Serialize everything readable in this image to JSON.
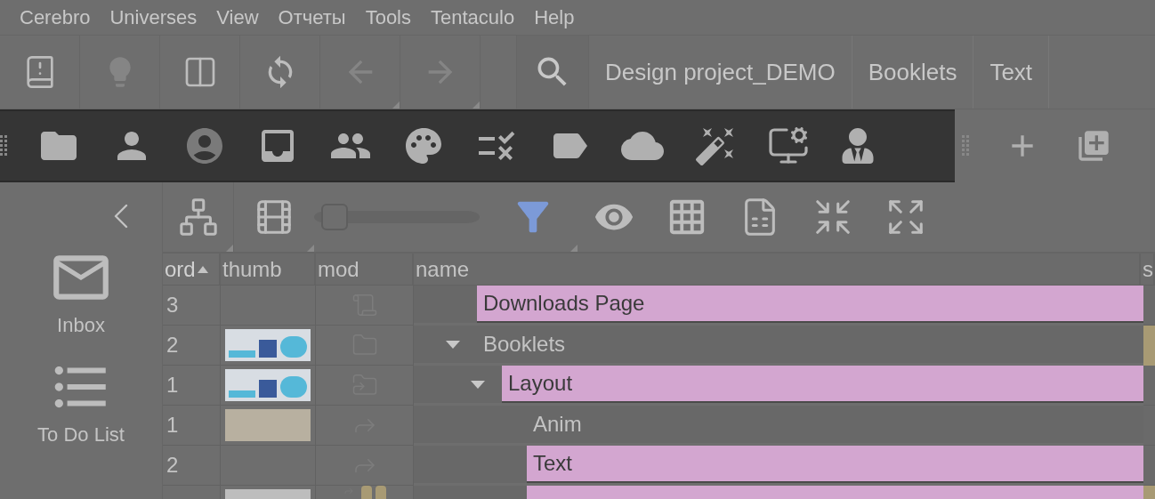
{
  "menu": [
    "Cerebro",
    "Universes",
    "View",
    "Отчеты",
    "Tools",
    "Tentaculo",
    "Help"
  ],
  "toolbar": [
    {
      "kind": "notes",
      "disabled": false
    },
    {
      "kind": "idea",
      "disabled": true
    },
    {
      "kind": "book",
      "disabled": false
    },
    {
      "kind": "refresh",
      "disabled": false
    },
    {
      "kind": "back",
      "disabled": true
    },
    {
      "kind": "forward",
      "disabled": true
    }
  ],
  "breadcrumbs": [
    "Design project_DEMO",
    "Booklets",
    "Text"
  ],
  "dark_toolbar": [
    {
      "kind": "folder"
    },
    {
      "kind": "person"
    },
    {
      "kind": "account"
    },
    {
      "kind": "inbox"
    },
    {
      "kind": "people"
    },
    {
      "kind": "palette"
    },
    {
      "kind": "rule"
    },
    {
      "kind": "label"
    },
    {
      "kind": "cloud"
    },
    {
      "kind": "magic"
    },
    {
      "kind": "monitor"
    },
    {
      "kind": "agent"
    }
  ],
  "side_tools": [
    {
      "kind": "add"
    },
    {
      "kind": "add-box"
    }
  ],
  "sidebar": {
    "items": [
      {
        "label": "Inbox",
        "kind": "mail"
      },
      {
        "label": "To Do List",
        "kind": "list"
      }
    ]
  },
  "view_toolbar": {
    "zoom": {
      "level": 0.05
    },
    "filter_active": true
  },
  "table": {
    "columns": [
      {
        "label": "ord",
        "sorted": true
      },
      {
        "label": "thumb",
        "sorted": false
      },
      {
        "label": "mod",
        "sorted": false
      },
      {
        "label": "name",
        "sorted": false
      },
      {
        "label": "s",
        "sorted": false
      }
    ],
    "rows": [
      {
        "ord": "3",
        "mod": {
          "kind": "scroll"
        },
        "name": "Downloads Page",
        "highlighted": true,
        "flag": false
      },
      {
        "ord": "2",
        "thumb": {
          "kind": "ui"
        },
        "mod": {
          "kind": "folder"
        },
        "name": "Booklets",
        "highlighted": false,
        "flag": true,
        "expanded": true,
        "children": [
          {
            "ord": "1",
            "thumb": {
              "kind": "ui"
            },
            "mod": {
              "kind": "folder-forward"
            },
            "name": "Layout",
            "highlighted": true,
            "flag": false,
            "expanded": true,
            "children": [
              {
                "ord": "1",
                "thumb": {
                  "kind": "photo"
                },
                "mod": {
                  "kind": "forward"
                },
                "name": "Anim",
                "highlighted": false,
                "flag": false
              },
              {
                "ord": "2",
                "mod": {
                  "kind": "forward"
                },
                "name": "Text",
                "highlighted": true,
                "flag": false
              },
              {
                "thumb": {
                  "kind": "gray"
                },
                "mod": {
                  "kind": "forward-tags"
                },
                "highlighted": true,
                "flag": true
              }
            ]
          }
        ]
      }
    ]
  }
}
